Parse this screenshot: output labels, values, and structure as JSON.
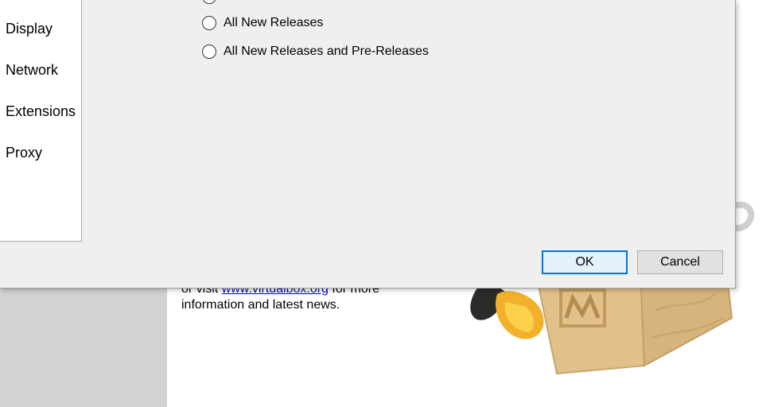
{
  "sidebar": {
    "items": [
      {
        "label": "Display"
      },
      {
        "label": "Network"
      },
      {
        "label": "Extensions"
      },
      {
        "label": "Proxy"
      }
    ]
  },
  "update": {
    "options": [
      {
        "label": "All New Releases",
        "selected": false
      },
      {
        "label": "All New Releases and Pre-Releases",
        "selected": false
      }
    ]
  },
  "buttons": {
    "ok": "OK",
    "cancel": "Cancel"
  },
  "background": {
    "text_prefix": "or visit ",
    "link": "www.virtualbox.org",
    "text_suffix": " for more",
    "line2": "information and latest news."
  }
}
